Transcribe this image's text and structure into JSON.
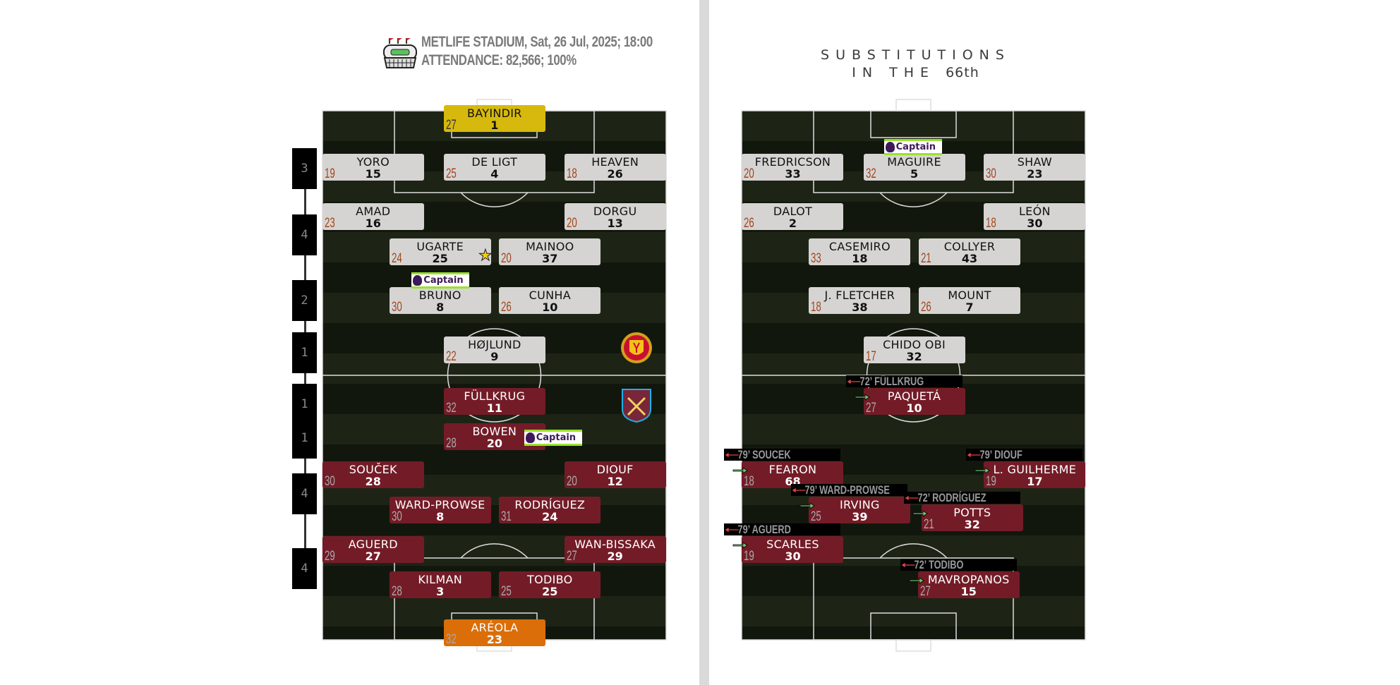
{
  "header": {
    "stadium_icon": "stadium-icon",
    "line1": "METLIFE STADIUM, Sat, 26 Jul, 2025; 18:00",
    "line2": "ATTENDANCE: 82,566; 100%"
  },
  "subs_title": {
    "line1": "SUBSTITUTIONS",
    "line2_prefix": "IN THE",
    "minute": "66th"
  },
  "formation": [
    "3",
    "4",
    "2",
    "1",
    "1",
    "1",
    "4",
    "4"
  ],
  "colors": {
    "home_card": "#d6d4d3",
    "away_card": "#731c27",
    "home_gk": "#d6b90c",
    "away_gk": "#db6e08",
    "pitch": "#1d2416",
    "captain_border": "#9be22d"
  },
  "captain_label": "Captain",
  "lineup": {
    "home": [
      {
        "name": "BAYINDIR",
        "age": "27",
        "number": "1",
        "gk": true
      },
      {
        "name": "YORO",
        "age": "19",
        "number": "15"
      },
      {
        "name": "DE LIGT",
        "age": "25",
        "number": "4"
      },
      {
        "name": "HEAVEN",
        "age": "18",
        "number": "26"
      },
      {
        "name": "AMAD",
        "age": "23",
        "number": "16"
      },
      {
        "name": "DORGU",
        "age": "20",
        "number": "13"
      },
      {
        "name": "UGARTE",
        "age": "24",
        "number": "25",
        "star": true
      },
      {
        "name": "MAINOO",
        "age": "20",
        "number": "37"
      },
      {
        "name": "BRUNO",
        "age": "30",
        "number": "8",
        "captain": true
      },
      {
        "name": "CUNHA",
        "age": "26",
        "number": "10"
      },
      {
        "name": "HØJLUND",
        "age": "22",
        "number": "9"
      }
    ],
    "away": [
      {
        "name": "FÜLLKRUG",
        "age": "32",
        "number": "11"
      },
      {
        "name": "BOWEN",
        "age": "28",
        "number": "20",
        "captain": true
      },
      {
        "name": "SOUČEK",
        "age": "30",
        "number": "28"
      },
      {
        "name": "DIOUF",
        "age": "20",
        "number": "12"
      },
      {
        "name": "WARD-PROWSE",
        "age": "30",
        "number": "8"
      },
      {
        "name": "RODRÍGUEZ",
        "age": "31",
        "number": "24"
      },
      {
        "name": "AGUERD",
        "age": "29",
        "number": "27"
      },
      {
        "name": "WAN-BISSAKA",
        "age": "27",
        "number": "29"
      },
      {
        "name": "KILMAN",
        "age": "28",
        "number": "3"
      },
      {
        "name": "TODIBO",
        "age": "25",
        "number": "25"
      },
      {
        "name": "ARÉOLA",
        "age": "32",
        "number": "23",
        "gk": true
      }
    ]
  },
  "substitutions": {
    "home": [
      {
        "name": "FREDRICSON",
        "age": "20",
        "number": "33"
      },
      {
        "name": "MAGUIRE",
        "age": "32",
        "number": "5",
        "captain": true
      },
      {
        "name": "SHAW",
        "age": "30",
        "number": "23"
      },
      {
        "name": "DALOT",
        "age": "26",
        "number": "2"
      },
      {
        "name": "LEÓN",
        "age": "18",
        "number": "30"
      },
      {
        "name": "CASEMIRO",
        "age": "33",
        "number": "18"
      },
      {
        "name": "COLLYER",
        "age": "21",
        "number": "43"
      },
      {
        "name": "J. FLETCHER",
        "age": "18",
        "number": "38"
      },
      {
        "name": "MOUNT",
        "age": "26",
        "number": "7"
      },
      {
        "name": "CHIDO OBI",
        "age": "17",
        "number": "32"
      }
    ],
    "away": [
      {
        "name": "PAQUETÁ",
        "age": "27",
        "number": "10",
        "off": "72’ FÜLLKRUG"
      },
      {
        "name": "FEARON",
        "age": "18",
        "number": "68",
        "off": "79’ SOUCEK"
      },
      {
        "name": "L. GUILHERME",
        "age": "19",
        "number": "17",
        "off": "79’ DIOUF"
      },
      {
        "name": "IRVING",
        "age": "25",
        "number": "39",
        "off": "79’ WARD-PROWSE"
      },
      {
        "name": "POTTS",
        "age": "21",
        "number": "32",
        "off": "72’ RODRÍGUEZ"
      },
      {
        "name": "SCARLES",
        "age": "19",
        "number": "30",
        "off": "79’ AGUERD"
      },
      {
        "name": "MAVROPANOS",
        "age": "27",
        "number": "15",
        "off": "72’ TODIBO"
      }
    ]
  }
}
